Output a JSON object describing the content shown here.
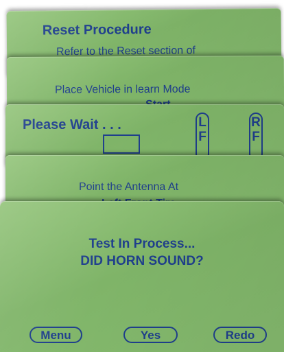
{
  "screens": {
    "reset": {
      "title": "Reset Procedure",
      "subtitle": "Refer to the Reset section of"
    },
    "learn": {
      "line1": "Place Vehicle in learn Mode",
      "line2": "Start"
    },
    "wait": {
      "title": "Please Wait . . .",
      "left_tire": [
        "L",
        "F"
      ],
      "right_tire": [
        "R",
        "F"
      ]
    },
    "antenna": {
      "line1": "Point the Antenna At",
      "line2": "Left Front Tire"
    },
    "test": {
      "message1": "Test In Process...",
      "message2": "DID HORN SOUND?",
      "buttons": {
        "menu": "Menu",
        "yes": "Yes",
        "redo": "Redo"
      }
    }
  },
  "colors": {
    "screen_green": "#86bb6f",
    "text_blue": "#1f3f8c"
  }
}
